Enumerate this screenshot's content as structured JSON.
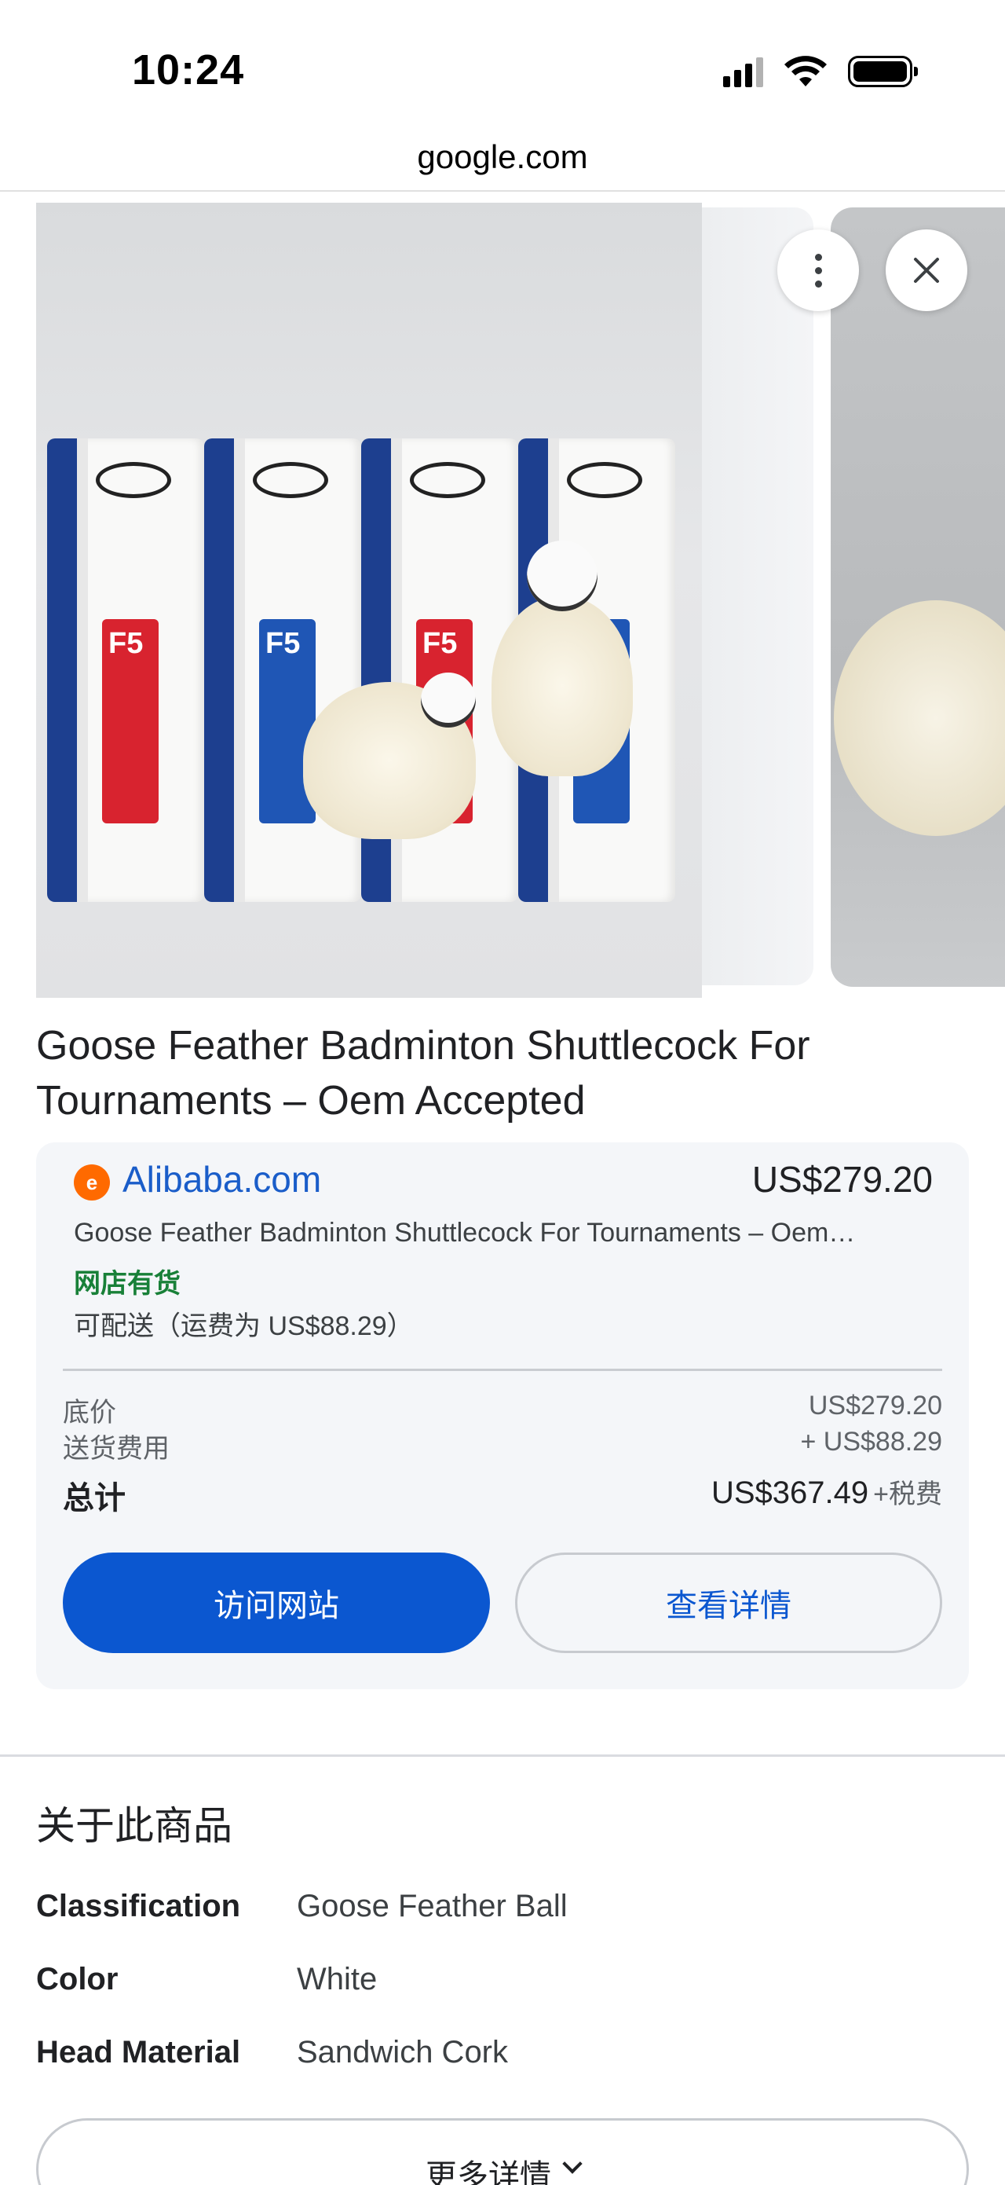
{
  "status_bar": {
    "time": "10:24"
  },
  "browser": {
    "url": "google.com"
  },
  "product": {
    "title": "Goose Feather Badminton Shuttlecock For Tournaments – Oem Accepted",
    "image_label": "F5"
  },
  "offer": {
    "merchant_logo_letter": "e",
    "merchant": "Alibaba.com",
    "price": "US$279.20",
    "description": "Goose Feather Badminton Shuttlecock For Tournaments – Oem…",
    "stock_status": "网店有货",
    "shipping": "可配送（运费为 US$88.29）",
    "base_price_label": "底价",
    "base_price_value": "US$279.20",
    "shipping_cost_label": "送货费用",
    "shipping_cost_value": "+ US$88.29",
    "total_label": "总计",
    "total_value": "US$367.49",
    "tax_note": "+税费",
    "visit_button": "访问网站",
    "details_button": "查看详情"
  },
  "about": {
    "heading": "关于此商品",
    "specs": [
      {
        "key": "Classification",
        "value": "Goose Feather Ball"
      },
      {
        "key": "Color",
        "value": "White"
      },
      {
        "key": "Head Material",
        "value": "Sandwich Cork"
      }
    ],
    "more_details": "更多详情"
  },
  "colors": {
    "accent": "#0b57d0",
    "link": "#1a5dc9",
    "stock_green": "#188038",
    "merchant_orange": "#ff6a00"
  },
  "icons": [
    "signal-icon",
    "wifi-icon",
    "battery-icon",
    "more-vert-icon",
    "close-icon",
    "chevron-down-icon"
  ]
}
